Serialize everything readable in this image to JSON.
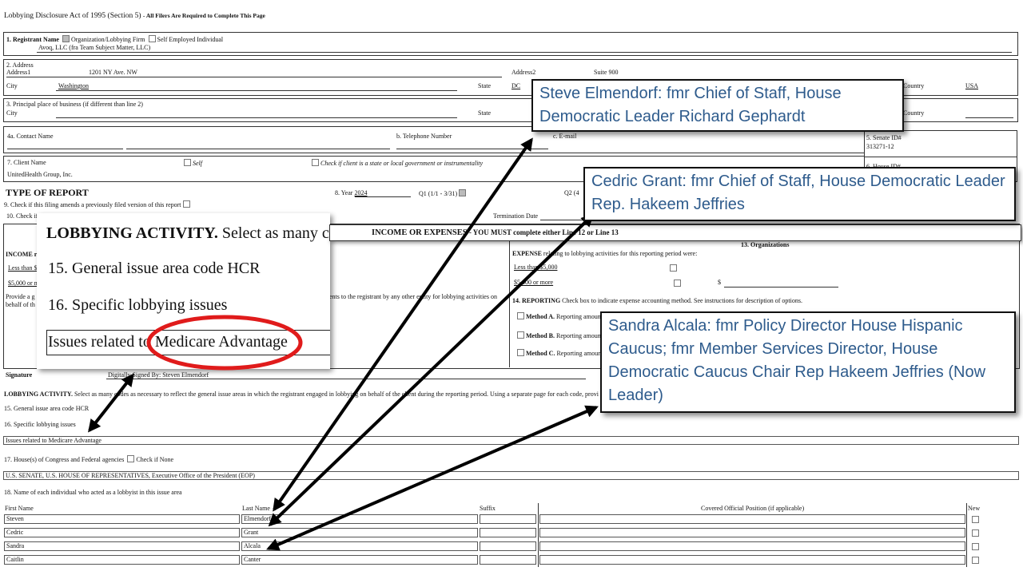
{
  "header": {
    "title": "Lobbying Disclosure Act of 1995 (Section 5)",
    "title_note": "- All Filers Are Required to Complete This Page"
  },
  "registrant": {
    "label": "1. Registrant Name",
    "org_option": "Organization/Lobbying Firm",
    "self_option": "Self Employed Individual",
    "name": "Avoq, LLC (fra Team Subject Matter, LLC)"
  },
  "address": {
    "label": "2. Address",
    "address1_label": "Address1",
    "address1": "1201 NY Ave. NW",
    "address2_label": "Address2",
    "address2": "Suite 900",
    "city_label": "City",
    "city": "Washington",
    "state_label": "State",
    "state": "DC",
    "country_label": "Country",
    "country": "USA"
  },
  "principal": {
    "label": "3. Principal place of business (if different than line 2)",
    "city_label": "City",
    "state_label": "State",
    "country_label": "Country"
  },
  "contact": {
    "contact_name_label": "4a. Contact Name",
    "telephone_label": "b. Telephone Number",
    "email_label": "c. E-mail",
    "senate_id_label": "5. Senate ID#",
    "senate_id": "313271-12",
    "house_id_label": "6. House ID#"
  },
  "client": {
    "label": "7. Client Name",
    "self_label": "Self",
    "state_gov_label": "Check if client is a state or local government or instrumentality",
    "name": "UnitedHealth Group, Inc."
  },
  "type_of_report": {
    "heading": "TYPE OF REPORT",
    "year_label": "8. Year",
    "year": "2024",
    "q1_label": "Q1 (1/1 - 3/31)",
    "q2_label": "Q2 (4",
    "amend_label": "9. Check if this filing amends a previously filed version of this report",
    "line10_label": "10. Check if",
    "termination_label": "Termination Date"
  },
  "income": {
    "partial_label": "INCOME r",
    "less_than": "Less than $",
    "five_k": "$5,000 or m",
    "provide": "Provide a g",
    "behalf": "behalf of th",
    "mid_text": "ents to the registrant by any other entity for lobbying activities on"
  },
  "income_expenses_banner": {
    "lead": "INCOME OR EXPENSES",
    "dash": " - YOU MUST complete either Line 12 or Line 13"
  },
  "expense": {
    "org_label": "13. Organizations",
    "expense_label": "EXPENSE",
    "expense_text": "relating to lobbying activities for this reporting period were:",
    "less_than": "Less than $5,000",
    "five_k": "$5,000 or more",
    "dollar": "$",
    "reporting_label": "14. REPORTING",
    "reporting_text": "Check box to indicate expense accounting method. See instructions for description of options.",
    "method_a": "Method A.",
    "method_b": "Method B.",
    "method_c": "Method C.",
    "reporting_amount": "Reporting amoun"
  },
  "signature": {
    "label": "Signature",
    "value": "Digitally Signed By: Steven Elmendorf"
  },
  "lobbying": {
    "heading": "LOBBYING ACTIVITY.",
    "heading_text": "Select as many codes as necessary to reflect the general issue areas in which the registrant engaged in lobbying on behalf of the client during the reporting period. Using a separate page for each code, provi",
    "line15": "15. General issue area code HCR",
    "line16": "16. Specific lobbying issues",
    "issues": "Issues related to Medicare Advantage",
    "line17": "17. House(s) of Congress and Federal agencies",
    "check_none": "Check if None",
    "agencies": "U.S. SENATE, U.S. HOUSE OF REPRESENTATIVES, Executive Office of the President (EOP)",
    "line18": "18. Name of each individual who acted as a lobbyist in this issue area"
  },
  "lobbyist_table": {
    "headers": {
      "first": "First Name",
      "last": "Last Name",
      "suffix": "Suffix",
      "covered": "Covered Official Position (if applicable)",
      "new": "New"
    },
    "rows": [
      {
        "first": "Steven",
        "last": "Elmendorf"
      },
      {
        "first": "Cedric",
        "last": "Grant"
      },
      {
        "first": "Sandra",
        "last": "Alcala"
      },
      {
        "first": "Caitlin",
        "last": "Canter"
      }
    ]
  },
  "zoom_inset": {
    "heading_bold": "LOBBYING ACTIVITY.",
    "heading_rest": " Select as many c",
    "line15": "15. General issue area code HCR",
    "line16": "16. Specific lobbying issues",
    "issues": "Issues related to Medicare Advantage"
  },
  "callouts": {
    "steve": "Steve Elmendorf: fmr Chief of Staff, House Democratic Leader Richard Gephardt",
    "cedric": "Cedric Grant: fmr Chief of Staff, House Democratic Leader Rep. Hakeem Jeffries",
    "sandra": "Sandra Alcala: fmr Policy Director House Hispanic Caucus; fmr Member Services Director, House Democratic Caucus Chair Rep Hakeem Jeffries (Now Leader)"
  },
  "colors": {
    "callout_text": "#2e5b8c",
    "highlight_ellipse": "#e01b1b",
    "arrow": "#000000"
  }
}
